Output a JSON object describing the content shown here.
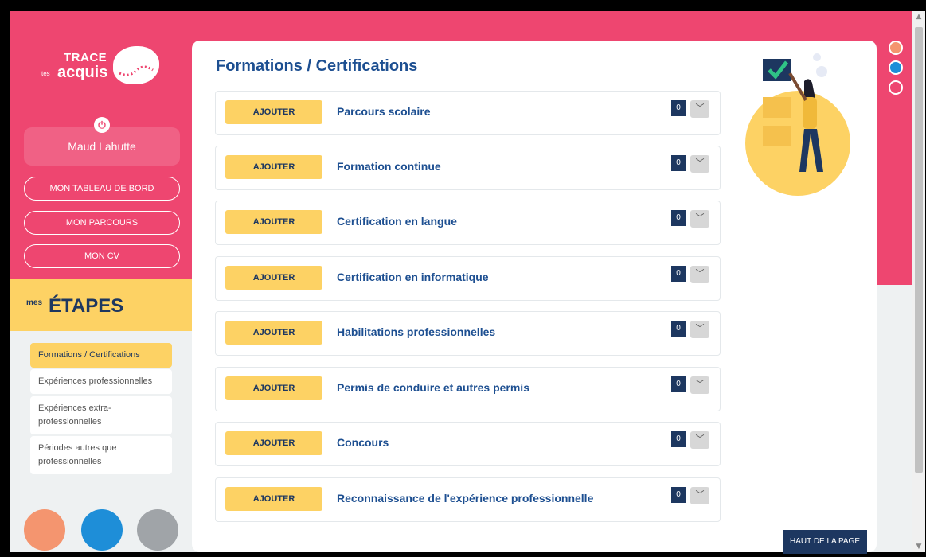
{
  "app": {
    "logo": {
      "line1": "TRACE",
      "line2": "tes",
      "line3": "acquis"
    },
    "user": {
      "name": "Maud Lahutte"
    }
  },
  "sidebar": {
    "nav": [
      {
        "label": "MON TABLEAU DE BORD"
      },
      {
        "label": "MON PARCOURS"
      },
      {
        "label": "MON CV"
      }
    ],
    "etapes_prefix": "mes",
    "etapes_title": "ÉTAPES",
    "steps": [
      {
        "label": "Formations / Certifications",
        "active": true
      },
      {
        "label": "Expériences professionnelles",
        "active": false
      },
      {
        "label": "Expériences extra-professionnelles",
        "active": false
      },
      {
        "label": "Périodes autres que professionnelles",
        "active": false
      }
    ]
  },
  "main": {
    "title": "Formations / Certifications",
    "add_label": "AJOUTER",
    "rows": [
      {
        "label": "Parcours scolaire",
        "count": "0"
      },
      {
        "label": "Formation continue",
        "count": "0"
      },
      {
        "label": "Certification en langue",
        "count": "0"
      },
      {
        "label": "Certification en informatique",
        "count": "0"
      },
      {
        "label": "Habilitations professionnelles",
        "count": "0"
      },
      {
        "label": "Permis de conduire et autres permis",
        "count": "0"
      },
      {
        "label": "Concours",
        "count": "0"
      },
      {
        "label": "Reconnaissance de l'expérience professionnelle",
        "count": "0"
      }
    ],
    "back_to_top": "HAUT DE LA PAGE"
  },
  "theme": {
    "pink": "#ee4670",
    "yellow": "#fdd264",
    "navy": "#1d3760",
    "title_blue": "#1d4f91"
  },
  "icons": {
    "power": "power-icon",
    "toggle": "chevron-down-icon",
    "scroll_up": "chevron-up-icon",
    "scroll_down": "chevron-down-icon"
  },
  "theme_dots": [
    {
      "color": "#f4956f"
    },
    {
      "color": "#1e8ed8"
    },
    {
      "color": "#ee4670"
    }
  ]
}
